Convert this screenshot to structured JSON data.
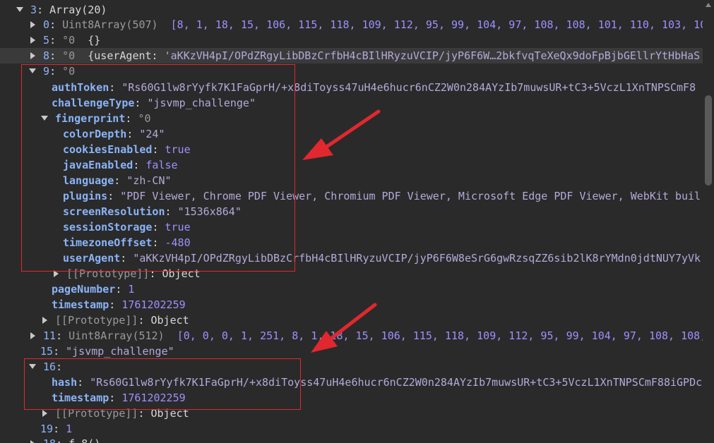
{
  "rows": {
    "r1": {
      "key": "3",
      "sep": ": ",
      "val": "Array(20)"
    },
    "r2": {
      "key": "0",
      "sep": ": ",
      "type": "Uint8Array(507)",
      "val": "[8, 1, 18, 15, 106, 115, 118, 109, 112, 95, 99, 104, 97, 108, 108, 101, 110, 103, 10"
    },
    "r3": {
      "key": "5",
      "sep": ": ",
      "type": "°0",
      "val": "{}"
    },
    "r4": {
      "key": "8",
      "sep": ": ",
      "type": "°0",
      "val": "{userAgent: ",
      "str": "'aKKzVH4pI/OPdZRgyLibDBzCrfbH4cBIlHRyzuVCIP/jyP6F6W…2bkfvqTeXeQx9doFpBjbGEllrYtHbHaS"
    },
    "r5": {
      "key": "9",
      "sep": ": ",
      "type": "°0"
    },
    "r6": {
      "key": "authToken",
      "sep": ": ",
      "val": "\"Rs60G1lw8rYyfk7K1FaGprH/+x8diToyss47uH4e6hucr6nCZ2W0n284AYzIb7muwsUR+tC3+5VczL1XnTNPSCmF8"
    },
    "r7": {
      "key": "challengeType",
      "sep": ": ",
      "val": "\"jsvmp_challenge\""
    },
    "r8": {
      "key": "fingerprint",
      "sep": ": ",
      "type": "°0"
    },
    "r9": {
      "key": "colorDepth",
      "sep": ": ",
      "val": "\"24\""
    },
    "r10": {
      "key": "cookiesEnabled",
      "sep": ": ",
      "val": "true"
    },
    "r11": {
      "key": "javaEnabled",
      "sep": ": ",
      "val": "false"
    },
    "r12": {
      "key": "language",
      "sep": ": ",
      "val": "\"zh-CN\""
    },
    "r13": {
      "key": "plugins",
      "sep": ": ",
      "val": "\"PDF Viewer, Chrome PDF Viewer, Chromium PDF Viewer, Microsoft Edge PDF Viewer, WebKit buil"
    },
    "r14": {
      "key": "screenResolution",
      "sep": ": ",
      "val": "\"1536x864\""
    },
    "r15": {
      "key": "sessionStorage",
      "sep": ": ",
      "val": "true"
    },
    "r16": {
      "key": "timezoneOffset",
      "sep": ": ",
      "val": "-480"
    },
    "r17": {
      "key": "userAgent",
      "sep": ": ",
      "val": "\"aKKzVH4pI/OPdZRgyLibDBzCrfbH4cBIlHRyzuVCIP/jyP6F6W8eSrG6gwRzsqZZ6sib2lK8rYMdn0jdtNUY7yVk"
    },
    "r18": {
      "key": "[[Prototype]]",
      "sep": ": ",
      "val": "Object"
    },
    "r19": {
      "key": "pageNumber",
      "sep": ": ",
      "val": "1"
    },
    "r20": {
      "key": "timestamp",
      "sep": ": ",
      "val": "1761202259"
    },
    "r21": {
      "key": "[[Prototype]]",
      "sep": ": ",
      "val": "Object"
    },
    "r22": {
      "key": "11",
      "sep": ": ",
      "type": "Uint8Array(512)",
      "val": "[0, 0, 0, 1, 251, 8, 1, 18, 15, 106, 115, 118, 109, 112, 95, 99, 104, 97, 108, 108,"
    },
    "r23": {
      "key": "15",
      "sep": ": ",
      "val": "\"jsvmp_challenge\""
    },
    "r24": {
      "key": "16",
      "sep": ":"
    },
    "r25": {
      "key": "hash",
      "sep": ": ",
      "val": "\"Rs60G1lw8rYyfk7K1FaGprH/+x8diToyss47uH4e6hucr6nCZ2W0n284AYzIb7muwsUR+tC3+5VczL1XnTNPSCmF88iGPDc"
    },
    "r26": {
      "key": "timestamp",
      "sep": ": ",
      "val": "1761202259"
    },
    "r27": {
      "key": "[[Prototype]]",
      "sep": ": ",
      "val": "Object"
    },
    "r28": {
      "key": "19",
      "sep": ": ",
      "val": "1"
    },
    "r29": {
      "key": "18",
      "sep": ": ",
      "val": "f 8()"
    }
  },
  "colors": {
    "annotation": "#e0282e",
    "background": "#2a2a2a",
    "key": "#8ab4f8",
    "string": "#b5a9d9",
    "number": "#9d91ff"
  }
}
